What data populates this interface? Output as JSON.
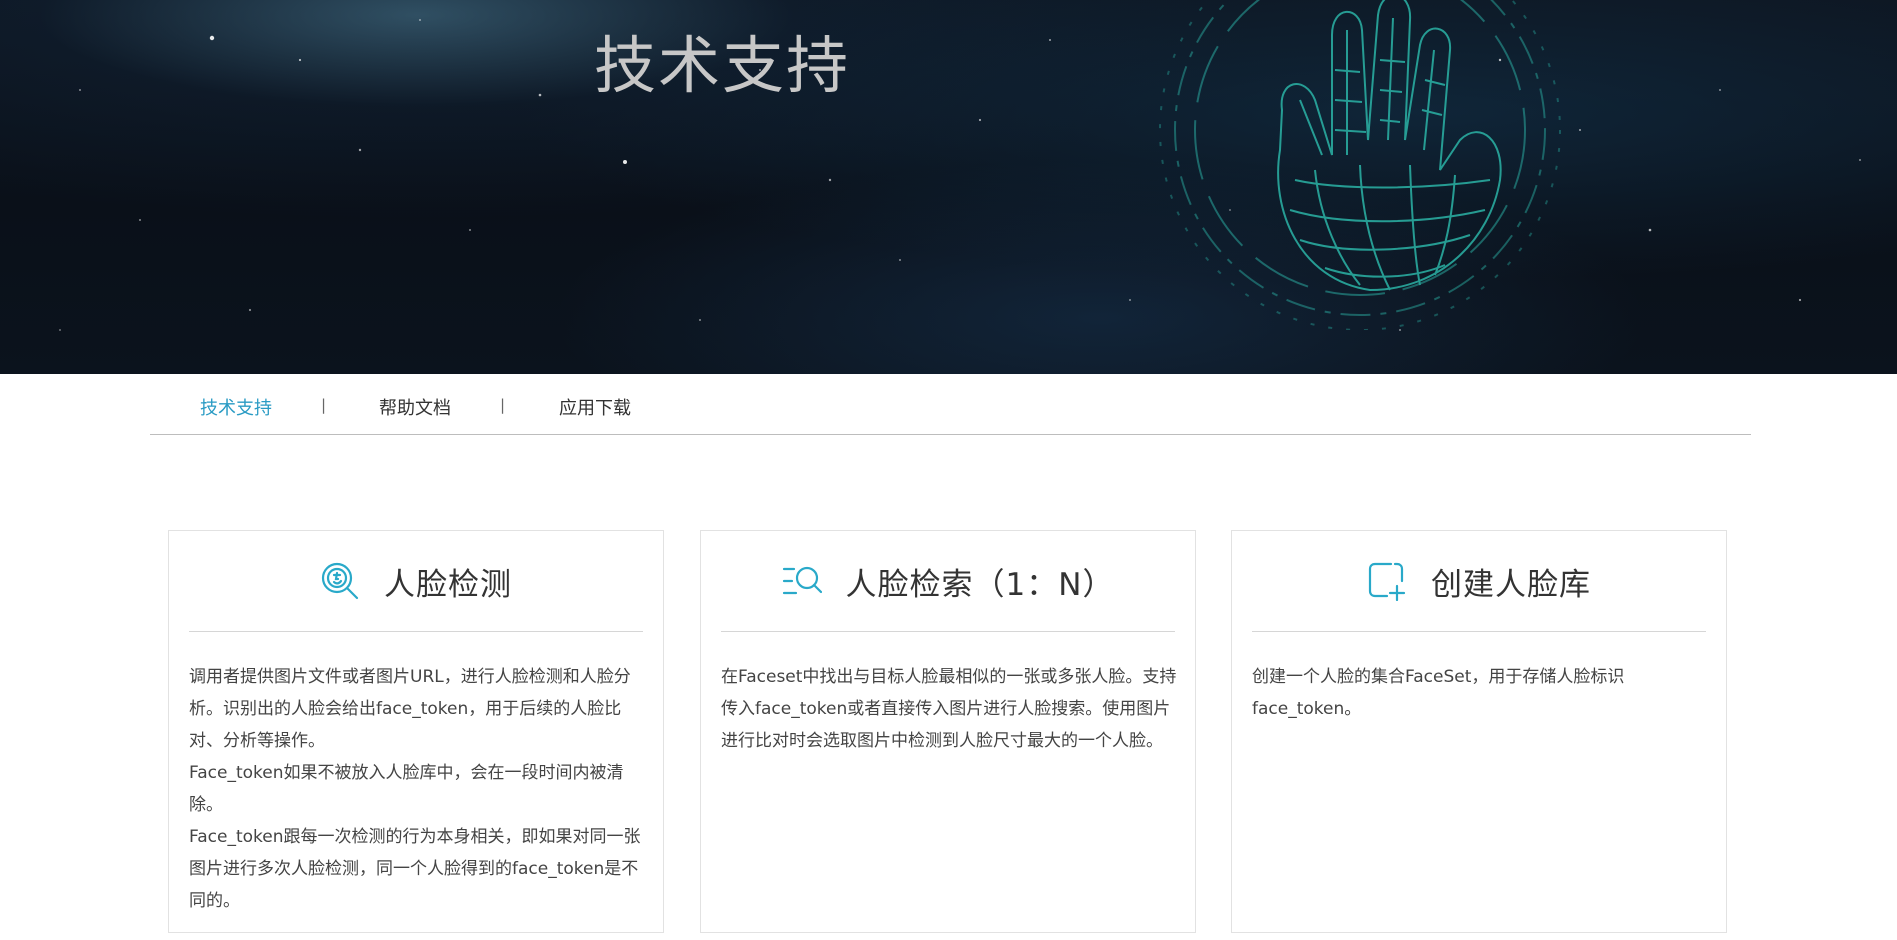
{
  "banner": {
    "title": "技术支持"
  },
  "tabs": [
    {
      "label": "技术支持",
      "active": true
    },
    {
      "label": "帮助文档",
      "active": false
    },
    {
      "label": "应用下载",
      "active": false
    }
  ],
  "tab_separator": "|",
  "cards": [
    {
      "icon": "face-detect-icon",
      "title": "人脸检测",
      "paragraphs": [
        "调用者提供图片文件或者图片URL，进行人脸检测和人脸分析。识别出的人脸会给出face_token，用于后续的人脸比对、分析等操作。",
        "Face_token如果不被放入人脸库中，会在一段时间内被清除。",
        "Face_token跟每一次检测的行为本身相关，即如果对同一张图片进行多次人脸检测，同一个人脸得到的face_token是不同的。"
      ]
    },
    {
      "icon": "list-search-icon",
      "title": "人脸检索（1：N）",
      "paragraphs": [
        "在Faceset中找出与目标人脸最相似的一张或多张人脸。支持传入face_token或者直接传入图片进行人脸搜索。使用图片进行比对时会选取图片中检测到人脸尺寸最大的一个人脸。"
      ]
    },
    {
      "icon": "add-library-icon",
      "title": "创建人脸库",
      "paragraphs": [
        "创建一个人脸的集合FaceSet，用于存储人脸标识face_token。"
      ]
    }
  ],
  "colors": {
    "accent": "#2a9bc4",
    "icon": "#29a9c9",
    "hand_wireframe": "#2bb3a6"
  }
}
